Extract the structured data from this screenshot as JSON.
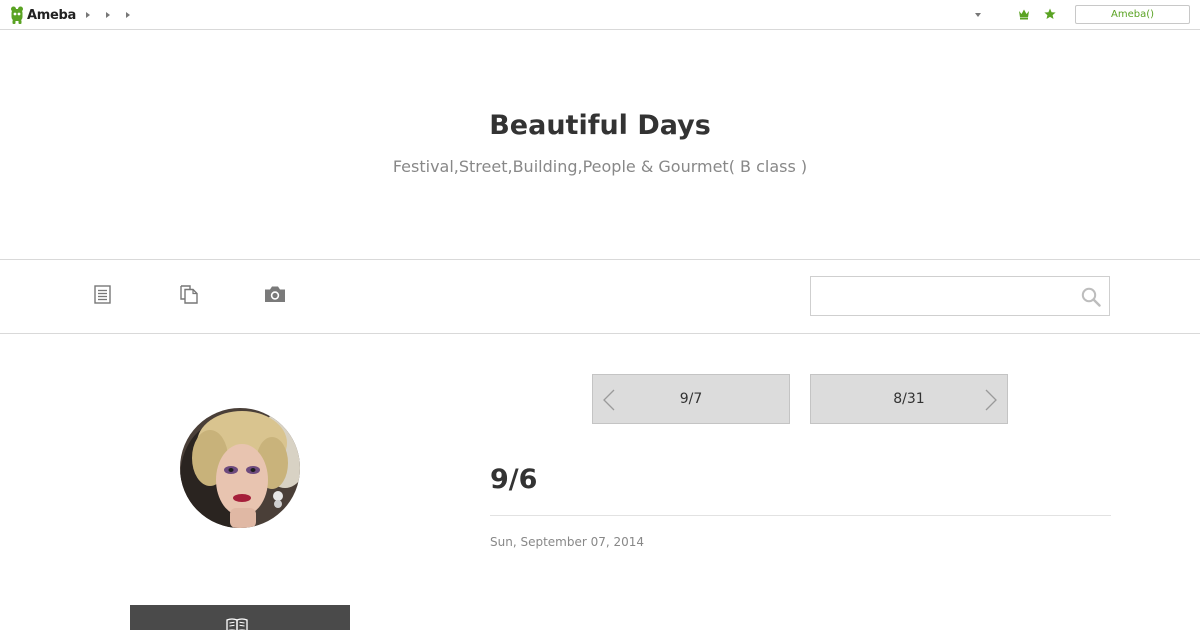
{
  "topbar": {
    "logo_text": "Ameba",
    "login_label": "Ameba()",
    "brand_color": "#5aa323",
    "icons": [
      "ameba-logo-icon",
      "crown-icon",
      "star-icon",
      "dropdown-arrow-icon"
    ]
  },
  "header": {
    "title": "Beautiful Days",
    "subtitle": "Festival,Street,Building,People & Gourmet( B class )"
  },
  "nav": {
    "icons": [
      "article-list-icon",
      "copy-icon",
      "camera-icon",
      "search-icon"
    ],
    "search": {
      "value": "",
      "placeholder": ""
    }
  },
  "sidebar": {
    "avatar": "profile-avatar",
    "button_icon": "book-icon",
    "button_color": "#4a4a4a"
  },
  "article": {
    "prev_label": "9/7",
    "next_label": "8/31",
    "title": "9/6",
    "date": "Sun, September 07, 2014"
  }
}
